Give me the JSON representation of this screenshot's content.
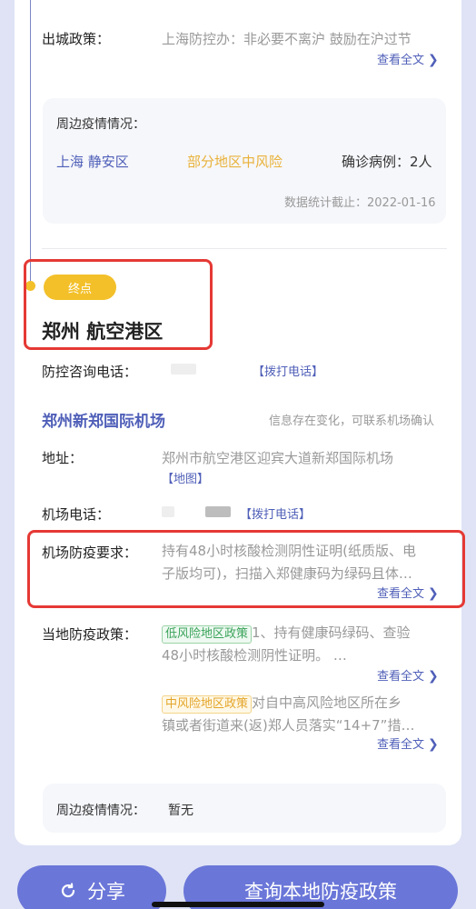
{
  "origin": {
    "exit_policy_label": "出城政策：",
    "exit_policy_text": "上海防控办：非必要不离沪 鼓励在沪过节",
    "view_full": "查看全文",
    "nearby": {
      "title": "周边疫情情况：",
      "location": "上海 静安区",
      "risk": "部分地区中风险",
      "cases": "确诊病例：2人",
      "stats_date": "数据统计截止：2022-01-16"
    }
  },
  "destination": {
    "badge": "终点",
    "city": "郑州 航空港区",
    "hotline_label": "防控咨询电话：",
    "call_link": "【拨打电话】",
    "airport": {
      "name": "郑州新郑国际机场",
      "note": "信息存在变化，可联系机场确认",
      "address_label": "地址：",
      "address": "郑州市航空港区迎宾大道新郑国际机场",
      "map_link": "【地图】",
      "phone_label": "机场电话：",
      "call_link": "【拨打电话】",
      "req_label": "机场防疫要求：",
      "req_line1": "持有48小时核酸检测阴性证明(纸质版、电",
      "req_line2": "子版均可)，扫描入郑健康码为绿码且体…",
      "view_full": "查看全文"
    },
    "local_policy": {
      "label": "当地防疫政策：",
      "low_tag": "低风险地区政策",
      "low_line1": "1、持有健康码绿码、查验",
      "low_line2": "48小时核酸检测阴性证明。 …",
      "view_full_1": "查看全文",
      "mid_tag": "中风险地区政策",
      "mid_line1": "对自中高风险地区所在乡",
      "mid_line2": "镇或者街道来(返)郑人员落实“14+7”措…",
      "view_full_2": "查看全文"
    },
    "nearby_label": "周边疫情情况：",
    "nearby_value": "暂无"
  },
  "actions": {
    "share": "分享",
    "query": "查询本地防疫政策"
  },
  "colors": {
    "accent": "#6a76d8",
    "link": "#4f5fb8",
    "warning": "#f3c02a",
    "highlight_box": "#e53935"
  }
}
